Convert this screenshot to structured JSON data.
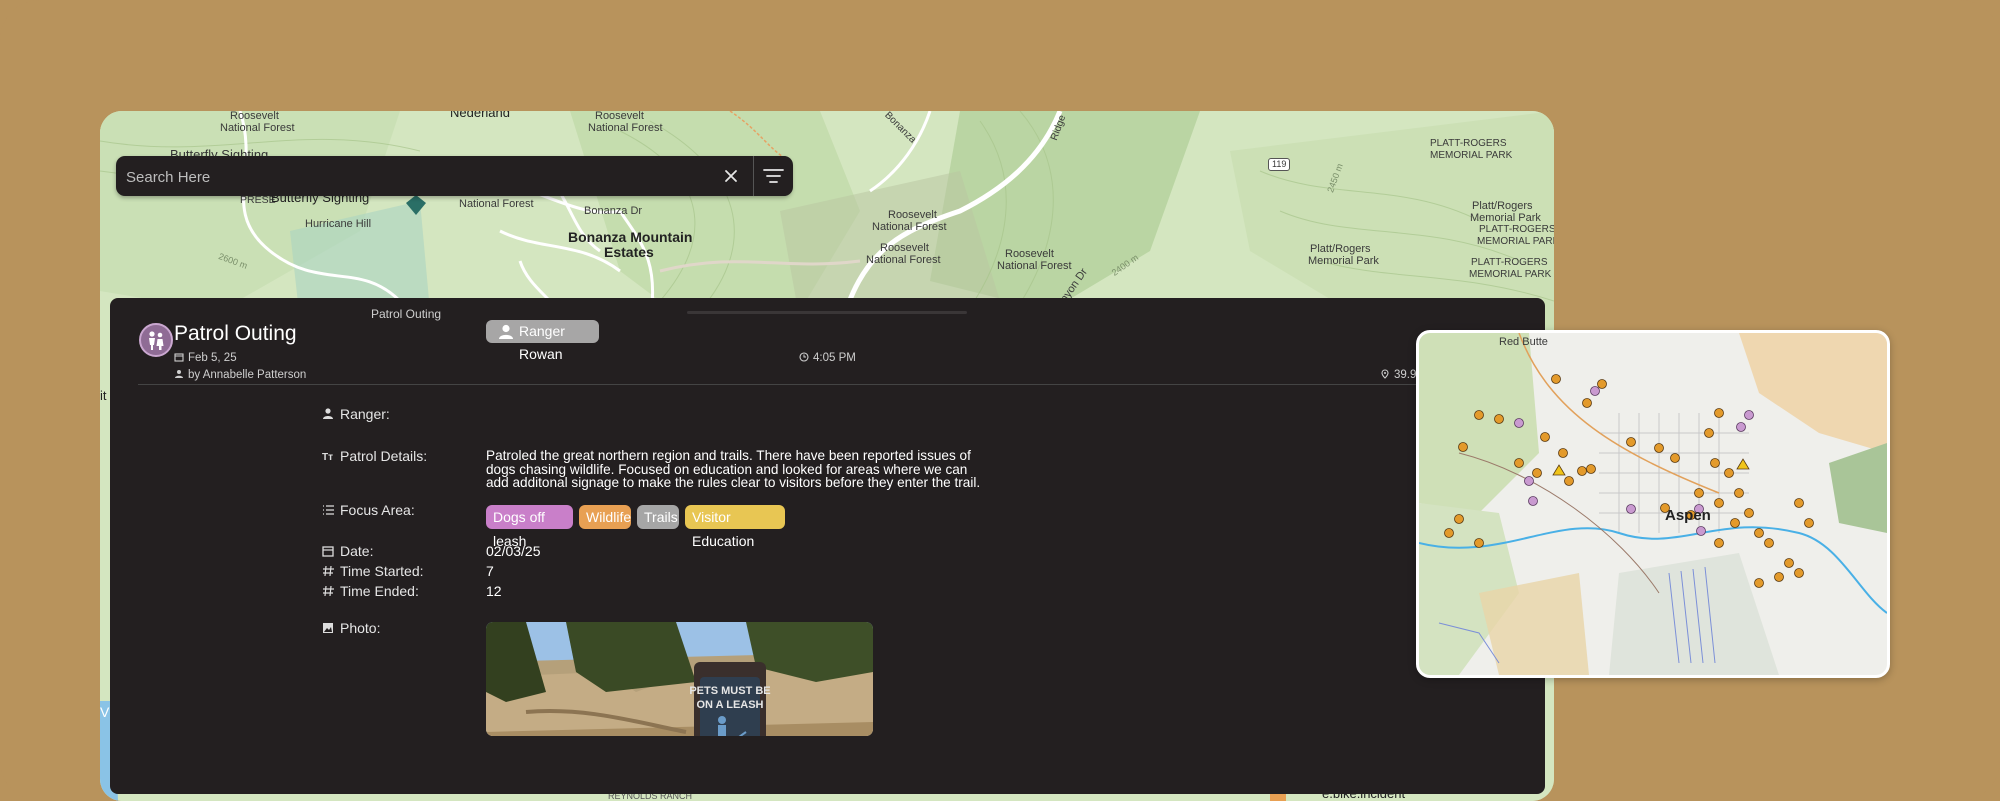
{
  "search": {
    "placeholder": "Search Here"
  },
  "map": {
    "labels": {
      "nederland": "Nederland",
      "roosevelt_nf_1": "Roosevelt",
      "roosevelt_nf_1b": "National Forest",
      "roosevelt_nf_2": "Roosevelt",
      "roosevelt_nf_2b": "National Forest",
      "butterfly_top": "Butterfly Sighting",
      "preserve": "PRESE",
      "butterfly": "Butterfly Sighting",
      "hurricane_hill": "Hurricane Hill",
      "national_forest": "National Forest",
      "bonanza_dr": "Bonanza Dr",
      "bonanza_estates_1": "Bonanza Mountain",
      "bonanza_estates_2": "Estates",
      "roosevelt_nf_3": "Roosevelt",
      "roosevelt_nf_3b": "National Forest",
      "roosevelt_nf_4": "Roosevelt",
      "roosevelt_nf_4b": "National Forest",
      "roosevelt_nf_5": "Roosevelt",
      "roosevelt_nf_5b": "National Forest",
      "route_119": "119",
      "bonanza_road": "Bonanza",
      "ridge": "Ridge",
      "canyon_dr": "anyon Dr",
      "elev_2400": "2400 m",
      "elev_2450": "2450 m",
      "elev_2600": "2600 m",
      "platt_rogers_1": "PLATT-ROGERS",
      "platt_rogers_1b": "MEMORIAL PARK",
      "platt_rogers_2": "Platt/Rogers",
      "platt_rogers_2b": "Memorial Park",
      "platt_rogers_3": "PLATT-ROGERS",
      "platt_rogers_3b": "MEMORIAL PARK",
      "platt_rogers_4": "Platt/Rogers",
      "platt_rogers_4b": "Memorial Park",
      "platt_rogers_5": "PLATT-ROGERS",
      "platt_rogers_5b": "MEMORIAL PARK",
      "bike_incident": "e.bike.incident",
      "reynolds_ranch": "REYNOLDS RANCH",
      "left_it": "it",
      "left_v": "V"
    }
  },
  "panel": {
    "breadcrumb": "Patrol Outing",
    "title": "Patrol Outing",
    "date": "Feb 5, 25",
    "author": "by Annabelle Patterson",
    "time": "4:05 PM",
    "coords": "39.9",
    "fields": {
      "ranger_label": "Ranger:",
      "ranger_value": "Ranger Rowan",
      "details_label": "Patrol Details:",
      "details_value": "Patroled the great northern region and trails. There have been reported issues of dogs chasing wildlife. Focused on education and looked for areas where we can add additonal signage to make the rules clear to visitors before they enter the trail.",
      "focus_label": "Focus Area:",
      "focus_tags": [
        {
          "label": "Dogs off leash",
          "color": "#c97fc9"
        },
        {
          "label": "Wildlife",
          "color": "#e8a053"
        },
        {
          "label": "Trails",
          "color": "#a6a6a6"
        },
        {
          "label": "Visitor Education",
          "color": "#e8c653"
        }
      ],
      "date_label": "Date:",
      "date_value": "02/03/25",
      "time_started_label": "Time Started:",
      "time_started_value": "7",
      "time_ended_label": "Time Ended:",
      "time_ended_value": "12",
      "photo_label": "Photo:",
      "photo_sign_1": "PETS MUST BE",
      "photo_sign_2": "ON A LEASH"
    }
  },
  "inset": {
    "labels": {
      "red_butte": "Red Butte",
      "aspen": "Aspen"
    }
  },
  "colors": {
    "background": "#b8935c",
    "panel": "#231f20",
    "map_green": "#cfe3b9"
  }
}
